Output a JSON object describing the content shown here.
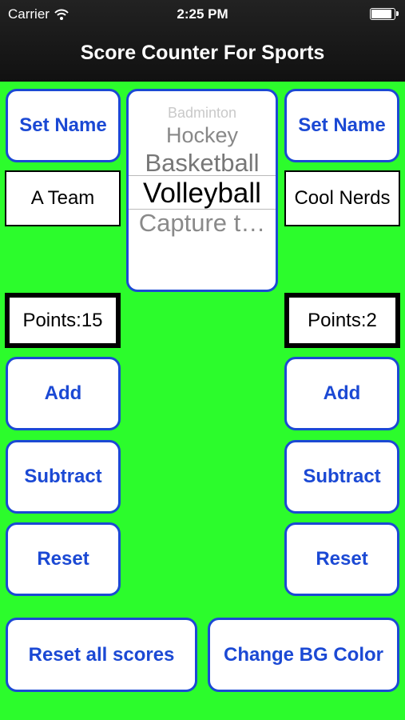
{
  "status_bar": {
    "carrier": "Carrier",
    "time": "2:25 PM",
    "battery_level": 0.95
  },
  "nav": {
    "title": "Score Counter For Sports"
  },
  "picker": {
    "items": [
      "Badminton",
      "Hockey",
      "Basketball",
      "Volleyball",
      "Capture t…"
    ],
    "selected": "Volleyball"
  },
  "left": {
    "set_name": "Set Name",
    "team_name": "A Team",
    "points": "Points:15",
    "add": "Add",
    "subtract": "Subtract",
    "reset": "Reset"
  },
  "right": {
    "set_name": "Set Name",
    "team_name": "Cool Nerds",
    "points": "Points:2",
    "add": "Add",
    "subtract": "Subtract",
    "reset": "Reset"
  },
  "bottom": {
    "reset_all": "Reset all scores",
    "change_bg": "Change BG Color"
  },
  "colors": {
    "background": "#2cfc2c",
    "accent": "#1b49d4",
    "navbar": "#1a1a1a"
  }
}
